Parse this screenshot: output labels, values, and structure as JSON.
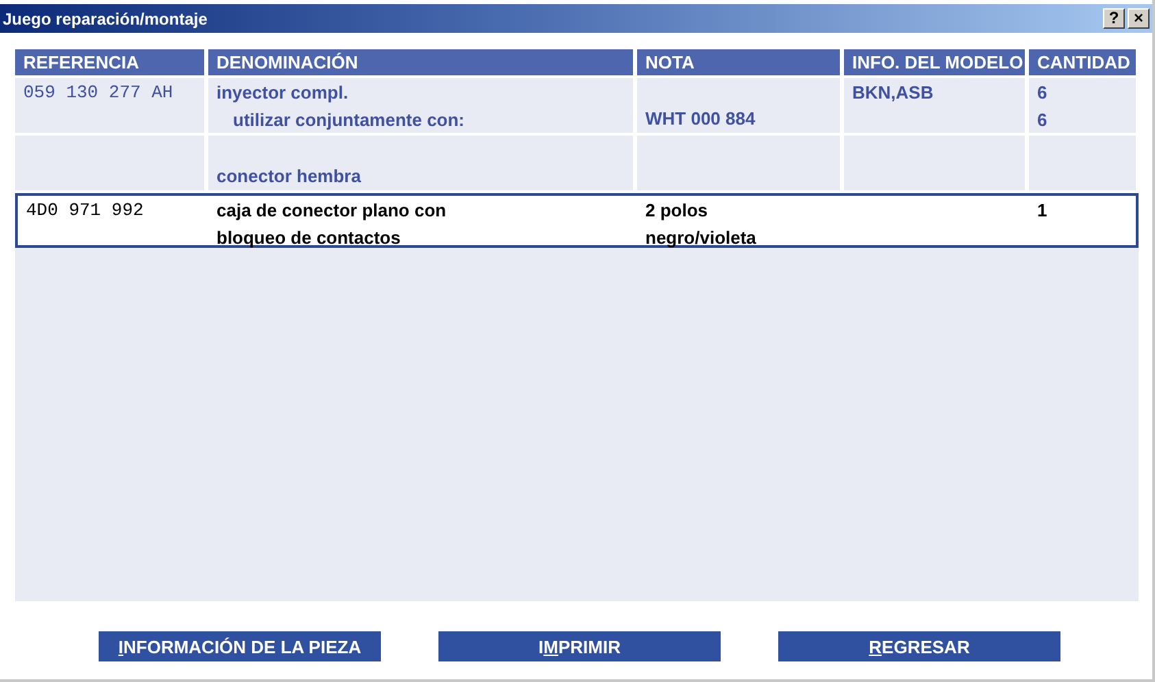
{
  "window": {
    "title": "Juego reparación/montaje",
    "title_buttons": [
      "?",
      "×"
    ]
  },
  "table": {
    "columns": [
      "REFERENCIA",
      "DENOMINACIÓN",
      "NOTA",
      "INFO. DEL MODELO",
      "CANTIDAD"
    ],
    "rows": [
      {
        "selected": false,
        "cells": [
          {
            "kind": "mono",
            "lines": [
              {
                "text": "059 130 277 AH"
              }
            ]
          },
          {
            "kind": "text",
            "lines": [
              {
                "text": "inyector compl."
              },
              {
                "text": "utilizar conjuntamente con:",
                "kind": "sub"
              }
            ]
          },
          {
            "kind": "text",
            "bottom": true,
            "lines": [
              {
                "text": "WHT 000 884"
              }
            ]
          },
          {
            "kind": "text",
            "lines": [
              {
                "text": "BKN,ASB"
              }
            ]
          },
          {
            "kind": "text",
            "lines": [
              {
                "text": "6"
              },
              {
                "text": "6"
              }
            ]
          }
        ]
      },
      {
        "selected": false,
        "cells": [
          {
            "kind": "mono"
          },
          {
            "kind": "text",
            "bottom": true,
            "lines": [
              {
                "text": "conector hembra"
              }
            ]
          },
          {
            "kind": "text"
          },
          {
            "kind": "text"
          },
          {
            "kind": "text"
          }
        ]
      },
      {
        "selected": true,
        "cells": [
          {
            "kind": "mono",
            "lines": [
              {
                "text": "4D0 971 992"
              }
            ]
          },
          {
            "kind": "text",
            "lines": [
              {
                "text": "caja de conector plano con"
              },
              {
                "text": "bloqueo de contactos"
              }
            ]
          },
          {
            "kind": "text",
            "lines": [
              {
                "text": "2 polos"
              },
              {
                "text": "negro/violeta"
              }
            ]
          },
          {
            "kind": "text"
          },
          {
            "kind": "text",
            "lines": [
              {
                "text": "1"
              }
            ]
          }
        ]
      }
    ]
  },
  "buttons": [
    {
      "key": "I",
      "rest": "NFORMACIÓN DE LA PIEZA"
    },
    {
      "lead": "I",
      "key": "M",
      "rest": "PRIMIR"
    },
    {
      "key": "R",
      "rest": "EGRESAR"
    }
  ]
}
